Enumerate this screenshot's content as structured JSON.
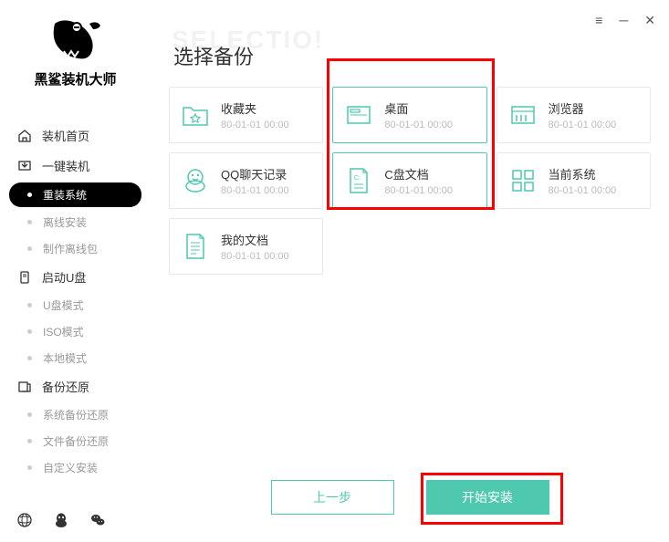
{
  "app": {
    "title": "黑鲨装机大师",
    "ghost": "SELECTIO!"
  },
  "nav": {
    "group1": {
      "label": "装机首页"
    },
    "group2": {
      "label": "一键装机"
    },
    "items2": [
      {
        "label": "重装系统",
        "active": true
      },
      {
        "label": "离线安装"
      },
      {
        "label": "制作离线包"
      }
    ],
    "group3": {
      "label": "启动U盘"
    },
    "items3": [
      {
        "label": "U盘模式"
      },
      {
        "label": "ISO模式"
      },
      {
        "label": "本地模式"
      }
    ],
    "group4": {
      "label": "备份还原"
    },
    "items4": [
      {
        "label": "系统备份还原"
      },
      {
        "label": "文件备份还原"
      },
      {
        "label": "自定义安装"
      }
    ]
  },
  "page": {
    "title": "选择备份"
  },
  "cards": [
    {
      "title": "收藏夹",
      "time": "80-01-01 00:00",
      "icon": "star-folder",
      "selected": false
    },
    {
      "title": "桌面",
      "time": "80-01-01 00:00",
      "icon": "desktop",
      "selected": true
    },
    {
      "title": "浏览器",
      "time": "80-01-01 00:00",
      "icon": "browser",
      "selected": false
    },
    {
      "title": "QQ聊天记录",
      "time": "80-01-01 00:00",
      "icon": "qq",
      "selected": false
    },
    {
      "title": "C盘文档",
      "time": "80-01-01 00:00",
      "icon": "cdoc",
      "selected": true
    },
    {
      "title": "当前系统",
      "time": "80-01-01 00:00",
      "icon": "system",
      "selected": false
    },
    {
      "title": "我的文档",
      "time": "80-01-01 00:00",
      "icon": "doc",
      "selected": false
    }
  ],
  "buttons": {
    "prev": "上一步",
    "start": "开始安装"
  }
}
